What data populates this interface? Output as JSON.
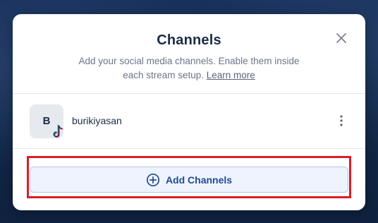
{
  "modal": {
    "title": "Channels",
    "subtitle": "Add your social media channels. Enable them inside each stream setup.",
    "learn_more": "Learn more",
    "close_icon": "close-icon"
  },
  "channels": [
    {
      "avatar_letter": "B",
      "platform_icon": "tiktok-icon",
      "name": "burikiyasan",
      "menu_icon": "more-vertical-icon"
    }
  ],
  "add_channels": {
    "label": "Add Channels",
    "icon": "plus-circle-icon"
  },
  "colors": {
    "accent": "#1f4d8f",
    "highlight": "#d81e2a",
    "button_bg": "#eef3fd",
    "title": "#1c2b45",
    "muted": "#6b7487"
  }
}
